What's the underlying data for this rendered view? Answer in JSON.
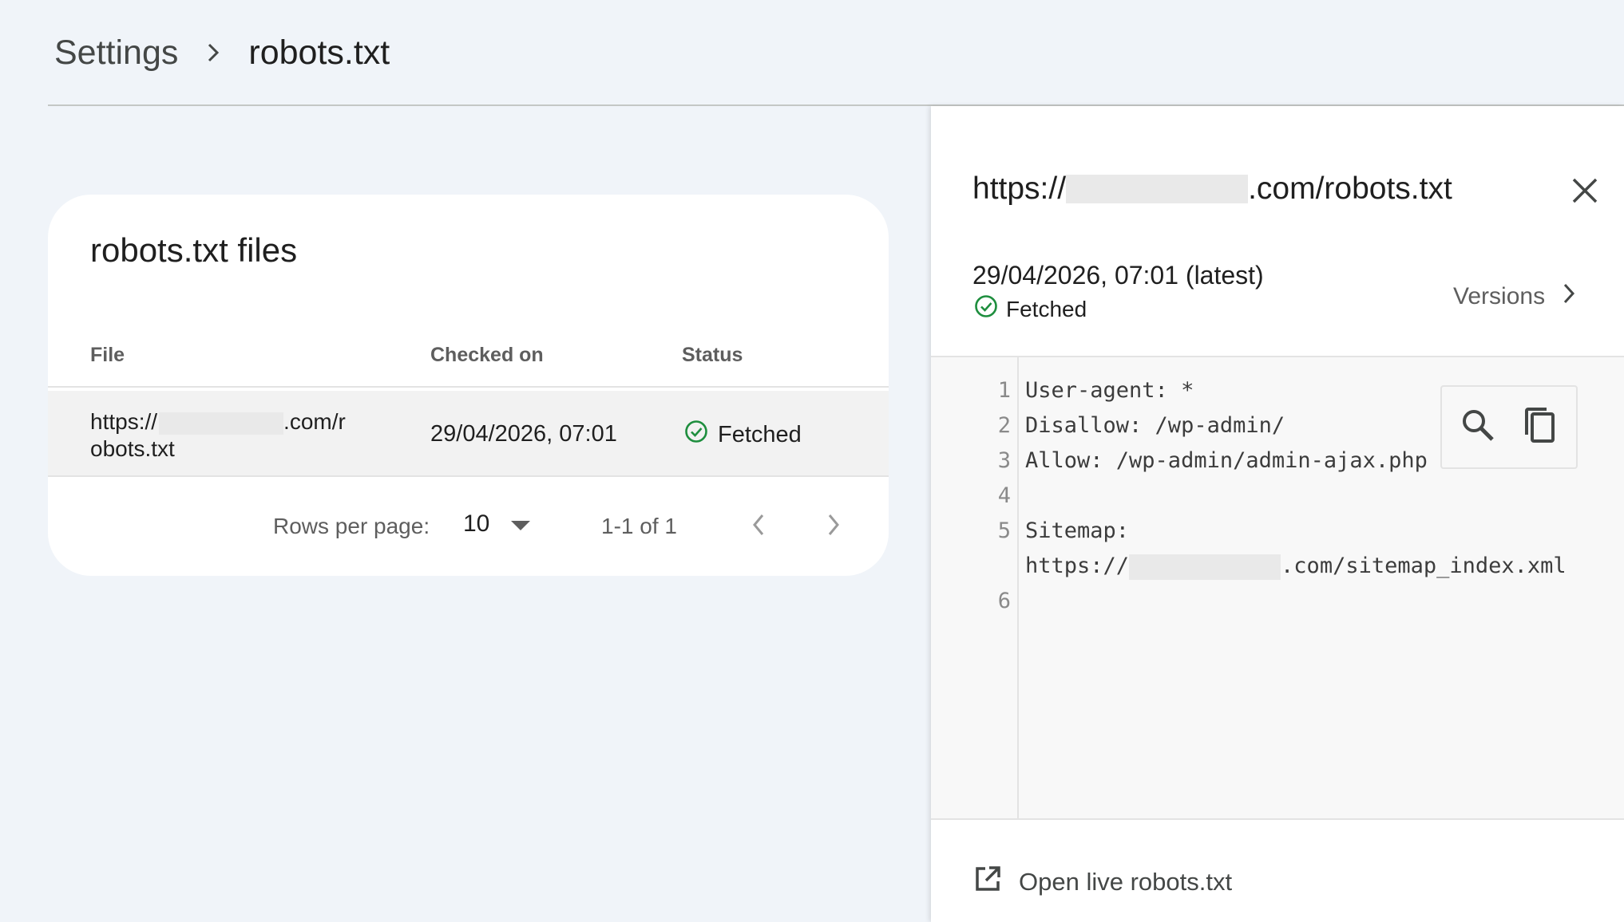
{
  "breadcrumb": {
    "root": "Settings",
    "current": "robots.txt"
  },
  "card": {
    "title": "robots.txt files",
    "columns": {
      "file": "File",
      "checked_on": "Checked on",
      "status": "Status"
    },
    "rows": [
      {
        "file_prefix": "https://",
        "file_suffix": ".com/r",
        "file_line2": "obots.txt",
        "checked_on": "29/04/2026, 07:01",
        "status": "Fetched"
      }
    ],
    "pagination": {
      "rows_per_page_label": "Rows per page:",
      "rows_per_page_value": "10",
      "range": "1-1 of 1"
    }
  },
  "panel": {
    "url_prefix": "https://",
    "url_suffix": ".com/robots.txt",
    "date": "29/04/2026, 07:01 (latest)",
    "status": "Fetched",
    "versions_label": "Versions",
    "code": [
      {
        "n": "1",
        "text": "User-agent: *"
      },
      {
        "n": "2",
        "text": "Disallow: /wp-admin/"
      },
      {
        "n": "3",
        "text": "Allow: /wp-admin/admin-ajax.php"
      },
      {
        "n": "4",
        "text": ""
      },
      {
        "n": "5",
        "text": "Sitemap:"
      },
      {
        "n": "",
        "text_prefix": "https://",
        "text_suffix": ".com/sitemap_index.xml"
      },
      {
        "n": "6",
        "text": ""
      }
    ],
    "open_live_label": "Open live robots.txt"
  },
  "colors": {
    "background": "#f0f4f9",
    "status_green": "#1e8e3e",
    "text_primary": "#1f1f1f",
    "text_secondary": "#5e5e5e"
  },
  "icons": [
    "chevron-right-icon",
    "check-circle-icon",
    "dropdown-arrow-icon",
    "chevron-left-icon",
    "close-icon",
    "search-icon",
    "copy-icon",
    "open-external-icon"
  ]
}
